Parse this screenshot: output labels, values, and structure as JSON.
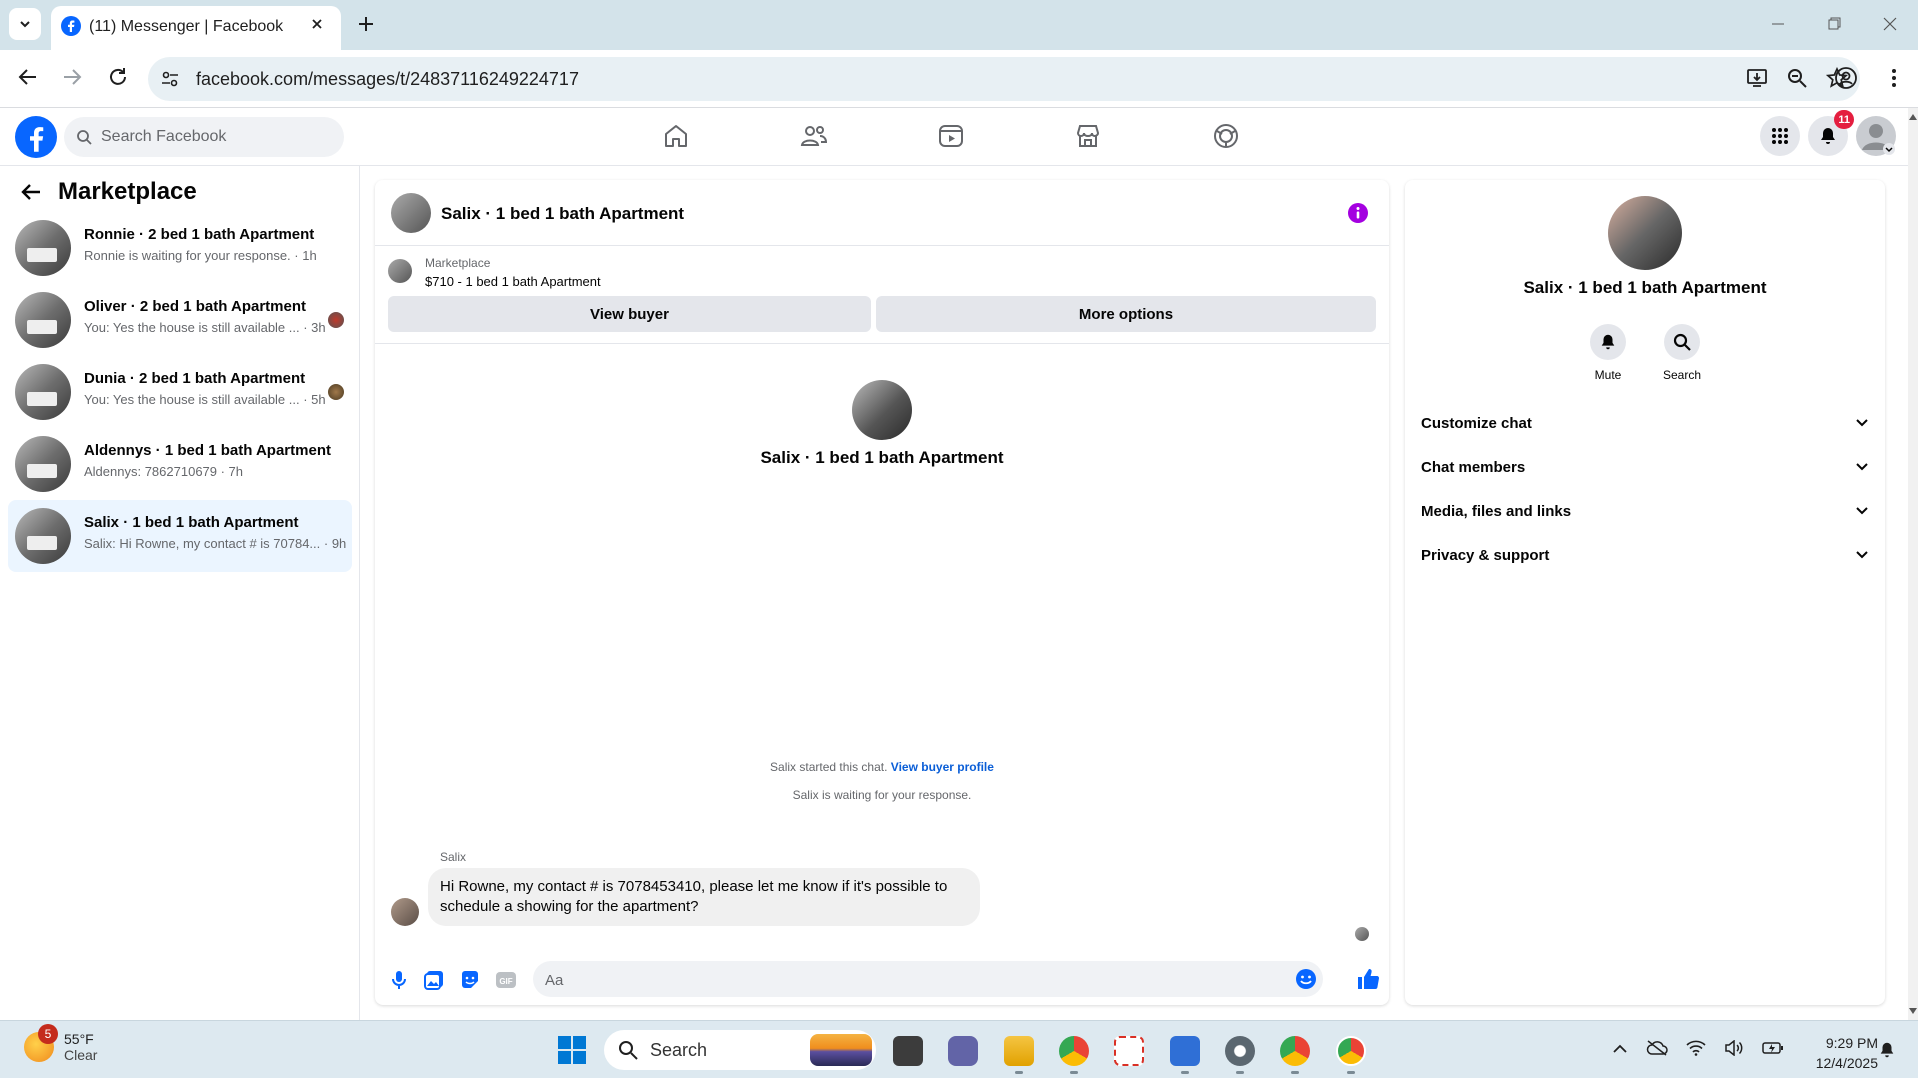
{
  "browser": {
    "tab_title": "(11) Messenger | Facebook",
    "url": "facebook.com/messages/t/24837116249224717"
  },
  "fb": {
    "search_placeholder": "Search Facebook",
    "notification_count": "11"
  },
  "left": {
    "title": "Marketplace",
    "conversations": [
      {
        "name": "Ronnie · 2 bed 1 bath Apartment",
        "preview": "Ronnie is waiting for your response. · 1h"
      },
      {
        "name": "Oliver · 2 bed 1 bath Apartment",
        "preview": "You: Yes the house is still available ... · 3h"
      },
      {
        "name": "Dunia · 2 bed 1 bath Apartment",
        "preview": "You: Yes the house is still available ... · 5h"
      },
      {
        "name": "Aldennys · 1 bed 1 bath Apartment",
        "preview": "Aldennys: 7862710679 · 7h"
      },
      {
        "name": "Salix · 1 bed 1 bath Apartment",
        "preview": "Salix: Hi Rowne, my contact # is 70784... · 9h"
      }
    ]
  },
  "chat": {
    "title": "Salix · 1 bed 1 bath Apartment",
    "marketplace_label": "Marketplace",
    "listing": "$710 - 1 bed 1 bath Apartment",
    "view_buyer": "View buyer",
    "more_options": "More options",
    "profile_name": "Salix · 1 bed 1 bath Apartment",
    "started_text": "Salix started this chat.",
    "view_buyer_profile": "View buyer profile",
    "waiting_text": "Salix is waiting for your response.",
    "sender": "Salix",
    "message": "Hi Rowne, my contact # is 7078453410, please let me know if it's possible to schedule a showing for the apartment?",
    "composer_placeholder": "Aa"
  },
  "right": {
    "name": "Salix · 1 bed 1 bath Apartment",
    "mute": "Mute",
    "search": "Search",
    "sections": [
      "Customize chat",
      "Chat members",
      "Media, files and links",
      "Privacy & support"
    ]
  },
  "taskbar": {
    "weather_badge": "5",
    "temp": "55°F",
    "condition": "Clear",
    "search": "Search",
    "time": "9:29 PM",
    "date": "12/4/2025"
  }
}
